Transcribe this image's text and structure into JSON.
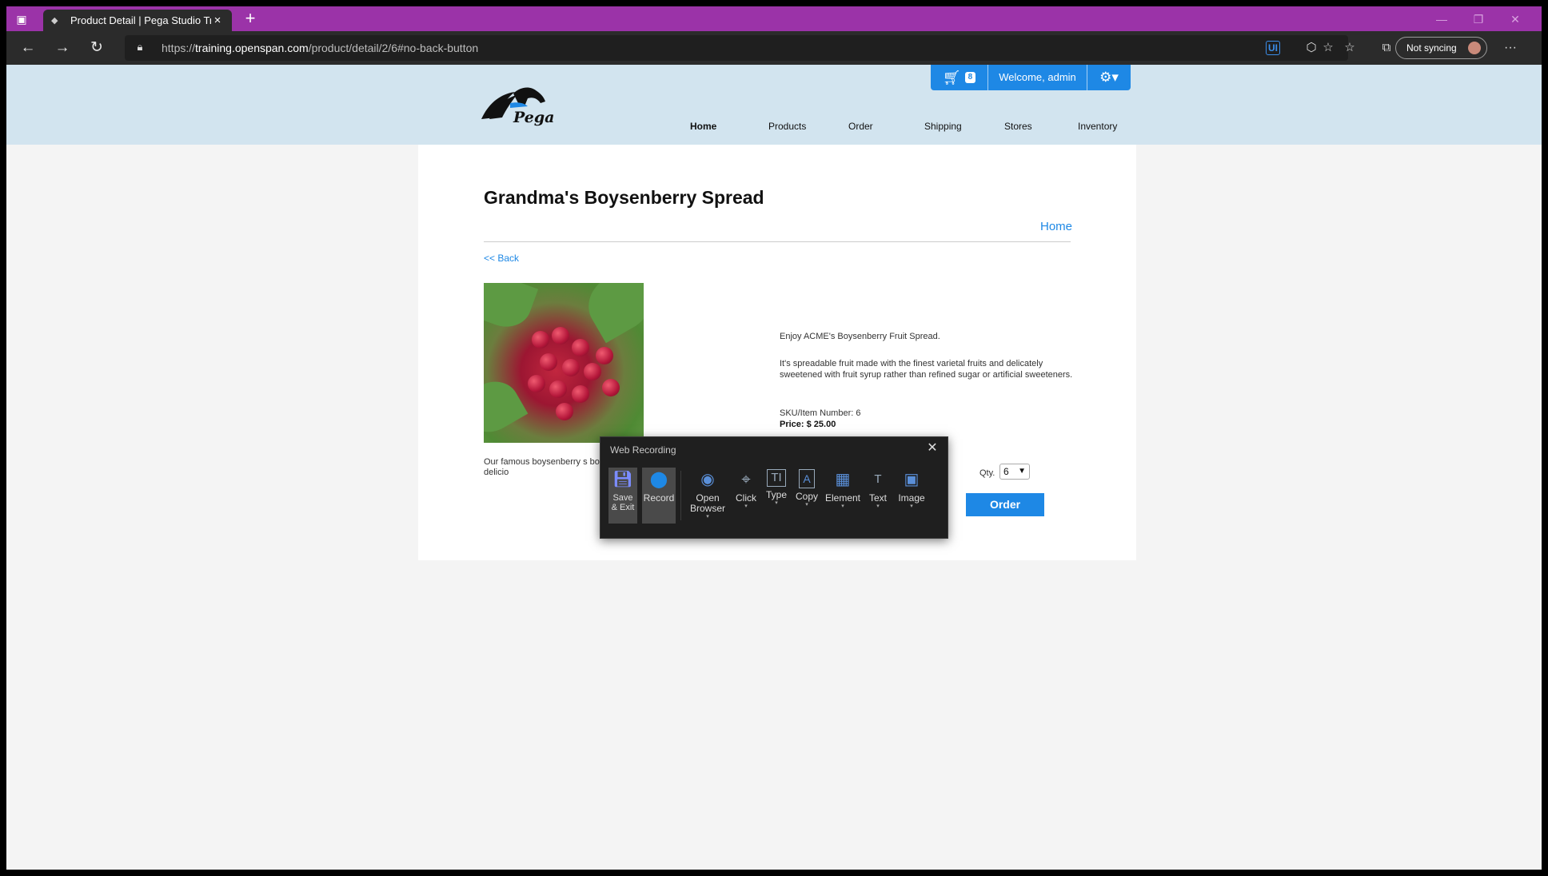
{
  "browser": {
    "tab_title": "Product Detail | Pega Studio Trai",
    "new_tab": "+",
    "url_prefix": "https://",
    "url_host": "training.openspan.com",
    "url_path": "/product/detail/2/6#no-back-button",
    "sync_label": "Not syncing"
  },
  "site": {
    "logo_text": "Pega",
    "cart_count": "8",
    "welcome": "Welcome, admin",
    "nav": [
      "Home",
      "Products",
      "Order",
      "Shipping",
      "Stores",
      "Inventory"
    ]
  },
  "product": {
    "title": "Grandma's Boysenberry Spread",
    "home_link": "Home",
    "back_link": "<< Back",
    "desc_left": "Our famous boysenberry s boysenberries. It is delicio",
    "intro": "Enjoy ACME's Boysenberry Fruit Spread.",
    "details": "It's spreadable fruit made with the finest varietal fruits and delicately sweetened with fruit syrup rather than refined sugar or artificial sweeteners.",
    "sku": "SKU/Item Number: 6",
    "price": "Price: $ 25.00",
    "qty_label": "Qty.",
    "qty_value": "6",
    "order_button": "Order"
  },
  "recorder": {
    "title": "Web Recording",
    "buttons": {
      "save": "Save & Exit",
      "record": "Record",
      "open_browser": "Open Browser",
      "click": "Click",
      "type": "Type",
      "copy": "Copy",
      "element": "Element",
      "text": "Text",
      "image": "Image"
    }
  },
  "colors": {
    "tabbar": "#9b33a8",
    "header": "#d2e4ef",
    "accent": "#1e88e5"
  }
}
